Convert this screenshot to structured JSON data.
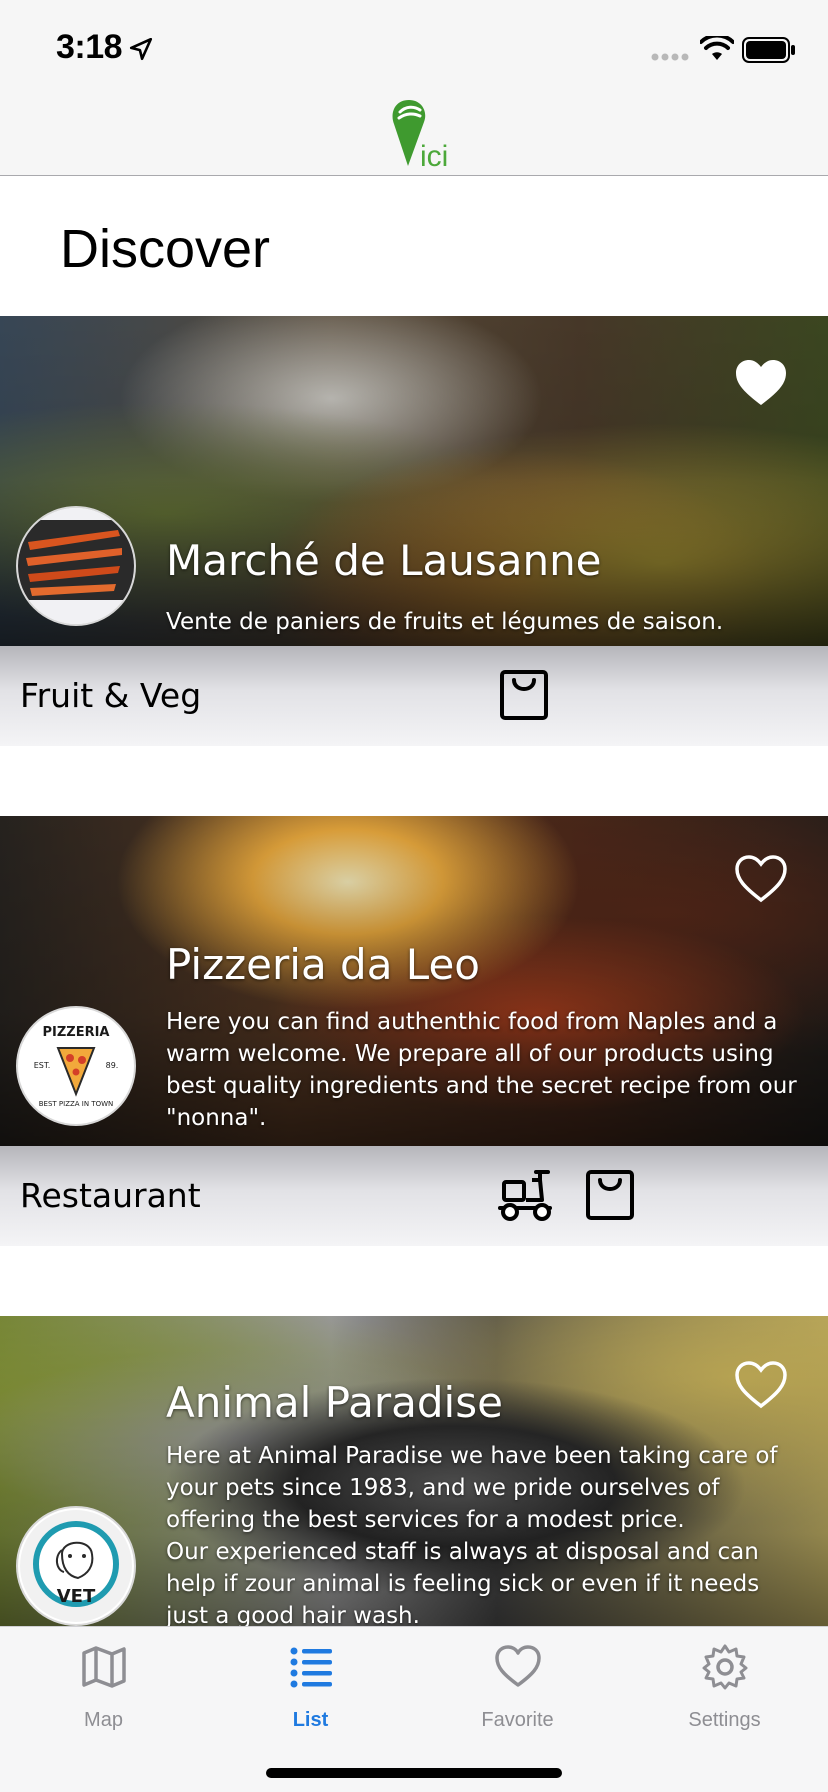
{
  "status_bar": {
    "time": "3:18"
  },
  "nav": {
    "logo_text": "ici",
    "logo_icon": "vici-pin-logo-icon"
  },
  "page": {
    "title": "Discover"
  },
  "cards": [
    {
      "name": "Marché de Lausanne",
      "description": "Vente de paniers de fruits et légumes de saison.",
      "category": "Fruit & Veg",
      "favorite": true,
      "services": [
        "shopping-bag-icon"
      ]
    },
    {
      "name": "Pizzeria da Leo",
      "description": "Here you can find authenthic food from Naples and a warm welcome. We prepare all of our products using best quality ingredients and the secret recipe from our \"nonna\".",
      "category": "Restaurant",
      "favorite": false,
      "services": [
        "delivery-scooter-icon",
        "shopping-bag-icon"
      ],
      "avatar": {
        "line1": "PIZZERIA",
        "left": "EST.",
        "right": "89.",
        "bottom": "BEST PIZZA IN TOWN"
      }
    },
    {
      "name": "Animal Paradise",
      "description": "Here at Animal Paradise we have been taking care of your pets since 1983, and we pride ourselves of offering the best services for a modest price.\nOur experienced staff is always at disposal  and can help if zour animal is feeling sick or even if it needs just a good hair wash.",
      "favorite": false,
      "avatar": {
        "text": "VET"
      }
    }
  ],
  "tabs": [
    {
      "label": "Map",
      "icon": "map-icon",
      "active": false
    },
    {
      "label": "List",
      "icon": "list-icon",
      "active": true
    },
    {
      "label": "Favorite",
      "icon": "heart-icon",
      "active": false
    },
    {
      "label": "Settings",
      "icon": "gear-icon",
      "active": false
    }
  ],
  "colors": {
    "accent": "#1f7ae0",
    "inactive": "#8e8e93",
    "brand_green": "#4ca83a"
  }
}
